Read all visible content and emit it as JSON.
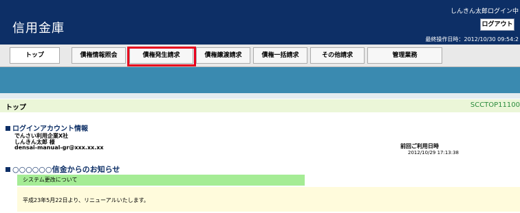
{
  "header": {
    "brand": "信用金庫",
    "user_line": "しんきん太郎ログイン中",
    "logout_label": "ログアウト",
    "last_operation": "最終操作日時：2012/10/30 09:54:2"
  },
  "tabs": [
    {
      "label": "トップ"
    },
    {
      "label": "債権情報照会"
    },
    {
      "label": "債権発生請求"
    },
    {
      "label": "債権譲渡請求"
    },
    {
      "label": "債権一括請求"
    },
    {
      "label": "その他請求"
    },
    {
      "label": "管理業務"
    }
  ],
  "page": {
    "title": "トップ",
    "id": "SCCTOP11100"
  },
  "account": {
    "section_title": "ログインアカウント情報",
    "company": "でんさい利用企業X社",
    "user": "しんきん太郎 様",
    "email": "densai-manual-gr@xxx.xx.xx",
    "last_use_label": "前回ご利用日時",
    "last_use_value": "2012/10/29 17:13:38"
  },
  "notice": {
    "section_title": "○○○○○○信金からのお知らせ",
    "heading": "システム更改について",
    "body": "平成23年5月22日より、リニューアルいたします。"
  },
  "colors": {
    "header_bg": "#0d2f66",
    "band_blue": "#3a8ab0",
    "highlight_red": "#e8001c",
    "page_bar": "#ebf6d8",
    "notice_head": "#a5ec95",
    "notice_body": "#fffbdc"
  }
}
